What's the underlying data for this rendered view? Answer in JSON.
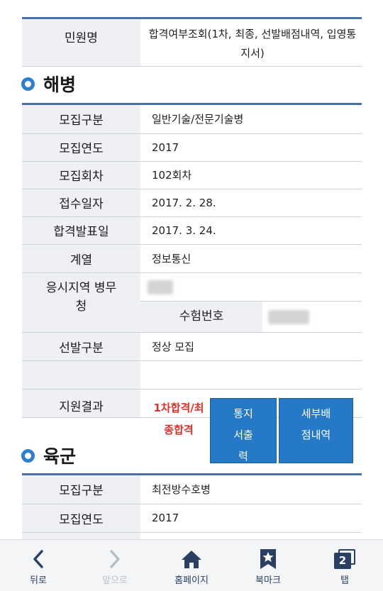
{
  "top": {
    "label": "민원명",
    "value": "합격여부조회(1차, 최종, 선발배점내역, 입영통지서)"
  },
  "navy": {
    "title": "해병",
    "rows": [
      {
        "label": "모집구분",
        "value": "일반기술/전문기술병"
      },
      {
        "label": "모집연도",
        "value": "2017"
      },
      {
        "label": "모집회차",
        "value": "102회차"
      },
      {
        "label": "접수일자",
        "value": "2017. 2. 28."
      },
      {
        "label": "합격발표일",
        "value": "2017. 3. 24."
      },
      {
        "label": "계열",
        "value": "정보통신"
      }
    ],
    "region_label": "응시지역 병무청",
    "exam_no_label": "수험번호",
    "selection_label": "선발구분",
    "selection_value": "정상 모집",
    "result_label": "지원결과",
    "result_value": "1차합격/최종합격",
    "notice_button": "통지서출력",
    "detail_button": "세부배점내역"
  },
  "army": {
    "title": "육군",
    "rows": [
      {
        "label": "모집구분",
        "value": "최전방수호병"
      },
      {
        "label": "모집연도",
        "value": "2017"
      }
    ]
  },
  "bottom_nav": {
    "back": "뒤로",
    "forward": "앞으로",
    "home": "홈페이지",
    "bookmark": "북마크",
    "tabs": "탭",
    "tab_count": "2"
  },
  "colors": {
    "accent": "#2679c6",
    "result_red": "#d8332a",
    "label_bg": "#eef0f3",
    "nav_icon": "#2b3f63"
  }
}
